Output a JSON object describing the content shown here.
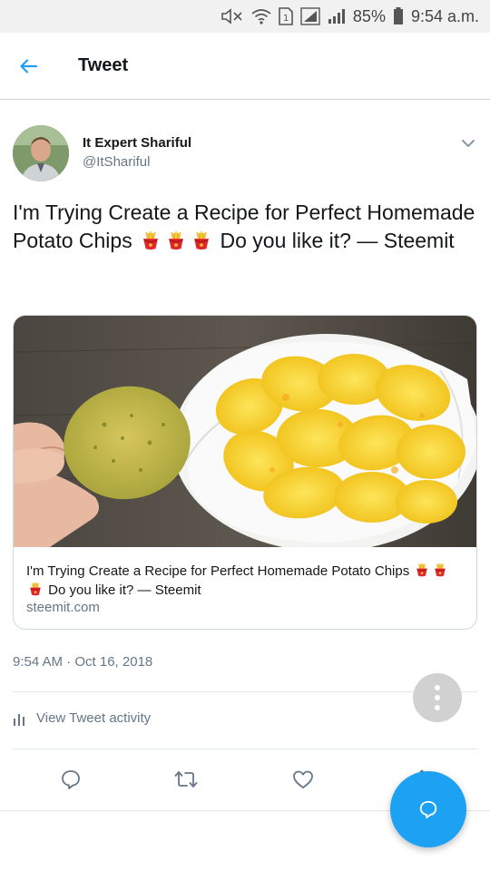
{
  "status_bar": {
    "battery": "85%",
    "time": "9:54 a.m.",
    "icons": [
      "mute-icon",
      "wifi-icon",
      "sim-icon",
      "signal-icon",
      "signal-icon",
      "battery-icon"
    ]
  },
  "header": {
    "title": "Tweet",
    "back_icon": "arrow-left-icon"
  },
  "tweet": {
    "author_name": "It Expert Shariful",
    "author_handle": "@ItShariful",
    "text_before_emoji": "I'm Trying Create a Recipe for Perfect Homemade Potato Chips",
    "text_after_emoji": "Do you like it? — Steemit",
    "emoji": "fries-emoji",
    "timestamp": "9:54 AM · Oct 16, 2018"
  },
  "card": {
    "title_before_emoji": "I'm Trying Create a Recipe for Perfect Homemade Potato Chips",
    "title_after_emoji": "Do you like it? — Steemit",
    "domain": "steemit.com",
    "image": "potato-chips-photo"
  },
  "activity": {
    "label": "View Tweet activity",
    "icon": "bar-chart-icon"
  },
  "actions": [
    "reply-icon",
    "retweet-icon",
    "like-icon",
    "share-icon"
  ],
  "colors": {
    "accent": "#1da1f2",
    "secondary_text": "#657786",
    "border": "#cfd6dc"
  }
}
